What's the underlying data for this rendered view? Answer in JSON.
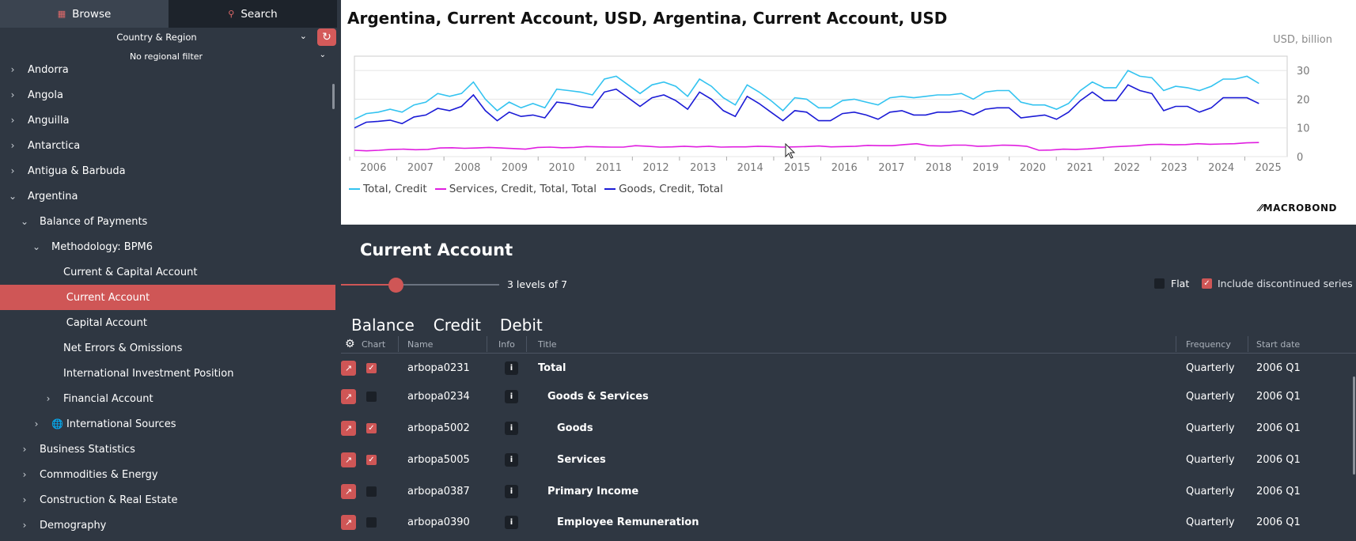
{
  "sidebar": {
    "tabs": [
      {
        "label": "Browse",
        "icon": "browse-icon"
      },
      {
        "label": "Search",
        "icon": "search-icon"
      }
    ],
    "region_select": "Country & Region",
    "regional_filter": "No regional filter",
    "tree": [
      {
        "label": "Andorra",
        "indent": 0,
        "arrow": "›",
        "selected": false
      },
      {
        "label": "Angola",
        "indent": 0,
        "arrow": "›",
        "selected": false
      },
      {
        "label": "Anguilla",
        "indent": 0,
        "arrow": "›",
        "selected": false
      },
      {
        "label": "Antarctica",
        "indent": 0,
        "arrow": "›",
        "selected": false
      },
      {
        "label": "Antigua & Barbuda",
        "indent": 0,
        "arrow": "›",
        "selected": false
      },
      {
        "label": "Argentina",
        "indent": 0,
        "arrow": "⌄",
        "selected": false
      },
      {
        "label": "Balance of Payments",
        "indent": 1,
        "arrow": "⌄",
        "selected": false
      },
      {
        "label": "Methodology: BPM6",
        "indent": 2,
        "arrow": "⌄",
        "selected": false
      },
      {
        "label": "Current & Capital Account",
        "indent": 3,
        "arrow": "",
        "selected": false
      },
      {
        "label": "Current Account",
        "indent": 3.25,
        "arrow": "",
        "selected": true
      },
      {
        "label": "Capital Account",
        "indent": 3.25,
        "arrow": "",
        "selected": false
      },
      {
        "label": "Net Errors & Omissions",
        "indent": 3,
        "arrow": "",
        "selected": false
      },
      {
        "label": "International Investment Position",
        "indent": 3,
        "arrow": "",
        "selected": false
      },
      {
        "label": "Financial Account",
        "indent": 3,
        "arrow": "›",
        "selected": false
      },
      {
        "label": "International Sources",
        "indent": 2,
        "arrow": "›",
        "selected": false,
        "globe": true
      },
      {
        "label": "Business Statistics",
        "indent": 1,
        "arrow": "›",
        "selected": false
      },
      {
        "label": "Commodities & Energy",
        "indent": 1,
        "arrow": "›",
        "selected": false
      },
      {
        "label": "Construction & Real Estate",
        "indent": 1,
        "arrow": "›",
        "selected": false
      },
      {
        "label": "Demography",
        "indent": 1,
        "arrow": "›",
        "selected": false
      }
    ]
  },
  "chart": {
    "title": "Argentina, Current Account, USD, Argentina, Current Account, USD",
    "unit": "USD, billion",
    "brand": "MACROBOND"
  },
  "chart_data": {
    "type": "line",
    "x_ticks": [
      "2006",
      "2007",
      "2008",
      "2009",
      "2010",
      "2011",
      "2012",
      "2013",
      "2014",
      "2015",
      "2016",
      "2017",
      "2018",
      "2019",
      "2020",
      "2021",
      "2022",
      "2023",
      "2024",
      "2025"
    ],
    "y_ticks": [
      0,
      10,
      20,
      30
    ],
    "ylim": [
      0,
      35
    ],
    "xlim": [
      2005.6,
      2025.4
    ],
    "series": [
      {
        "name": "Total, Credit",
        "color": "#33c3f0",
        "values": [
          13,
          15,
          15.5,
          16.5,
          15.5,
          18,
          19,
          22,
          21,
          22,
          26,
          20,
          16,
          19,
          17,
          18.5,
          17,
          23.5,
          23,
          22.5,
          21.5,
          27,
          28,
          25,
          22,
          25,
          26,
          24.5,
          21,
          27,
          24.5,
          20.5,
          18,
          25,
          22.5,
          19.5,
          16,
          20.5,
          20,
          17,
          17,
          19.5,
          20,
          19,
          18,
          20.5,
          21,
          20.5,
          21,
          21.5,
          21.5,
          22,
          20,
          22.5,
          23,
          23,
          19,
          18,
          18,
          16.5,
          18.5,
          23,
          26,
          24,
          24,
          30,
          28,
          27.5,
          23,
          24.5,
          24,
          23,
          24.5,
          27,
          27,
          28,
          25.5
        ]
      },
      {
        "name": "Services, Credit, Total, Total",
        "color": "#e01ee0",
        "values": [
          2.2,
          2,
          2.2,
          2.5,
          2.6,
          2.4,
          2.5,
          3,
          3.1,
          2.9,
          3,
          3.2,
          3,
          2.8,
          2.6,
          3.2,
          3.3,
          3.1,
          3.2,
          3.5,
          3.4,
          3.3,
          3.3,
          3.8,
          3.6,
          3.3,
          3.4,
          3.6,
          3.4,
          3.6,
          3.3,
          3.4,
          3.4,
          3.6,
          3.5,
          3.3,
          3.4,
          3.5,
          3.7,
          3.4,
          3.5,
          3.6,
          3.9,
          3.8,
          3.8,
          4.2,
          4.5,
          3.8,
          3.7,
          4,
          4,
          3.6,
          3.7,
          4,
          3.9,
          3.6,
          2.2,
          2.3,
          2.6,
          2.5,
          2.7,
          3,
          3.4,
          3.6,
          3.8,
          4.2,
          4.3,
          4.1,
          4.2,
          4.5,
          4.3,
          4.4,
          4.5,
          4.8,
          4.9
        ]
      },
      {
        "name": "Goods, Credit, Total",
        "color": "#1b1bd6",
        "values": [
          10,
          12,
          12.3,
          12.7,
          11.5,
          13.8,
          14.5,
          16.8,
          16,
          17.5,
          21.5,
          16,
          12.5,
          15.5,
          14,
          14.5,
          13.5,
          19,
          18.5,
          17.5,
          17,
          22.5,
          23.5,
          20.5,
          17.5,
          20.5,
          21.5,
          19.5,
          16.5,
          22.5,
          20,
          16,
          14,
          21,
          18.5,
          15.5,
          12.5,
          16,
          15.5,
          12.5,
          12.5,
          15,
          15.5,
          14.5,
          13,
          15.5,
          16,
          14.5,
          14.5,
          15.5,
          15.5,
          16,
          14.5,
          16.5,
          17,
          17,
          13.5,
          14,
          14.5,
          13,
          15.5,
          19.5,
          22.5,
          19.5,
          19.5,
          25,
          23,
          22,
          16,
          17.5,
          17.5,
          15.5,
          17,
          20.5,
          20.5,
          20.5,
          18.5
        ]
      }
    ]
  },
  "table": {
    "section_title": "Current Account",
    "levels_text": "3 levels of 7",
    "level_value": 3,
    "level_max": 7,
    "flat_label": "Flat",
    "discont_label": "Include discontinued series",
    "view_tabs": [
      "Balance",
      "Credit",
      "Debit"
    ],
    "headers": {
      "chart": "Chart",
      "name": "Name",
      "info": "Info",
      "title": "Title",
      "frequency": "Frequency",
      "start": "Start date"
    },
    "rows": [
      {
        "name": "arbopa0231",
        "title": "Total",
        "checked": true,
        "indent": 0,
        "frequency": "Quarterly",
        "start": "2006 Q1"
      },
      {
        "name": "arbopa0234",
        "title": "Goods & Services",
        "checked": false,
        "indent": 1,
        "frequency": "Quarterly",
        "start": "2006 Q1"
      },
      {
        "name": "arbopa5002",
        "title": "Goods",
        "checked": true,
        "indent": 2,
        "frequency": "Quarterly",
        "start": "2006 Q1"
      },
      {
        "name": "arbopa5005",
        "title": "Services",
        "checked": true,
        "indent": 2,
        "frequency": "Quarterly",
        "start": "2006 Q1"
      },
      {
        "name": "arbopa0387",
        "title": "Primary Income",
        "checked": false,
        "indent": 1,
        "frequency": "Quarterly",
        "start": "2006 Q1"
      },
      {
        "name": "arbopa0390",
        "title": "Employee Remuneration",
        "checked": false,
        "indent": 2,
        "frequency": "Quarterly",
        "start": "2006 Q1"
      }
    ]
  }
}
